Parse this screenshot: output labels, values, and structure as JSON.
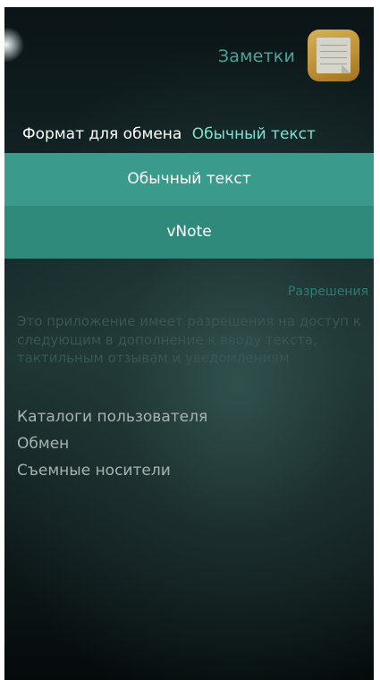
{
  "header": {
    "title": "Заметки",
    "app_icon": "notes-app-icon"
  },
  "sharing": {
    "label": "Формат для обмена",
    "value": "Обычный текст"
  },
  "dropdown": {
    "options": [
      {
        "label": "Обычный текст",
        "selected": true
      },
      {
        "label": "vNote",
        "selected": false
      }
    ]
  },
  "permissions": {
    "title": "Разрешения",
    "description": "Это приложение имеет разрешения на доступ к следующим в дополнение к вводу текста, тактильным отзывам и уведомлениям",
    "items": [
      "Каталоги пользователя",
      "Обмен",
      "Съемные носители"
    ]
  },
  "colors": {
    "accent": "#7ee3d1",
    "dropdown_bg": "#2f8a7c",
    "header_title": "#4ea396",
    "icon": "#e0aa45"
  }
}
